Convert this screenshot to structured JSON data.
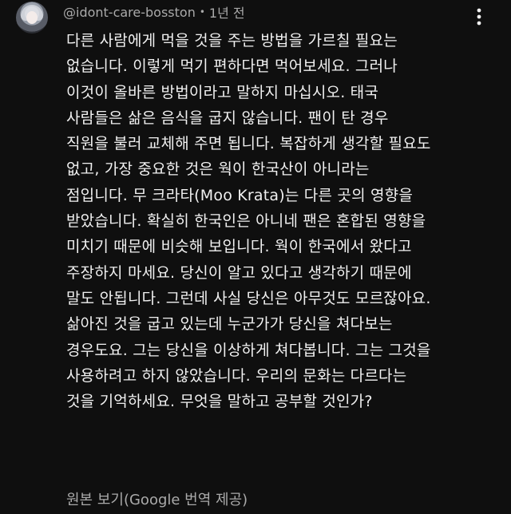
{
  "comment": {
    "author": "@idont-care-bosston",
    "separator": "•",
    "timestamp": "1년 전",
    "body_lines": [
      "다른 사람에게 먹을 것을 주는 방법을 가르칠 필요는",
      "없습니다. 이렇게 먹기 편하다면 먹어보세요. 그러나",
      "이것이 올바른 방법이라고 말하지 마십시오. 태국",
      "사람들은 삶은 음식을 굽지 않습니다. 팬이 탄 경우",
      "직원을 불러 교체해 주면 됩니다. 복잡하게 생각할 필요도",
      "없고, 가장 중요한 것은 웍이 한국산이 아니라는",
      "점입니다. 무 크라타(Moo Krata)는 다른 곳의 영향을",
      "받았습니다. 확실히 한국인은 아니네 팬은 혼합된 영향을",
      "미치기 때문에 비슷해 보입니다. 웍이 한국에서 왔다고",
      "주장하지 마세요. 당신이 알고 있다고 생각하기 때문에",
      "말도 안됩니다. 그런데 사실 당신은 아무것도 모르잖아요.",
      "삶아진 것을 굽고 있는데 누군가가 당신을 쳐다보는",
      "경우도요. 그는 당신을 이상하게 쳐다봅니다. 그는 그것을",
      "사용하려고 하지 않았습니다. 우리의 문화는 다르다는",
      "것을 기억하세요. 무엇을 말하고 공부할 것인가?"
    ],
    "see_original_label": "원본 보기(Google 번역 제공)",
    "more_icon": "vertical-ellipsis-icon",
    "avatar_icon": "user-avatar"
  },
  "colors": {
    "background": "#0f0f0f",
    "primary_text": "#f1f1f1",
    "secondary_text": "#aaaaaa"
  }
}
